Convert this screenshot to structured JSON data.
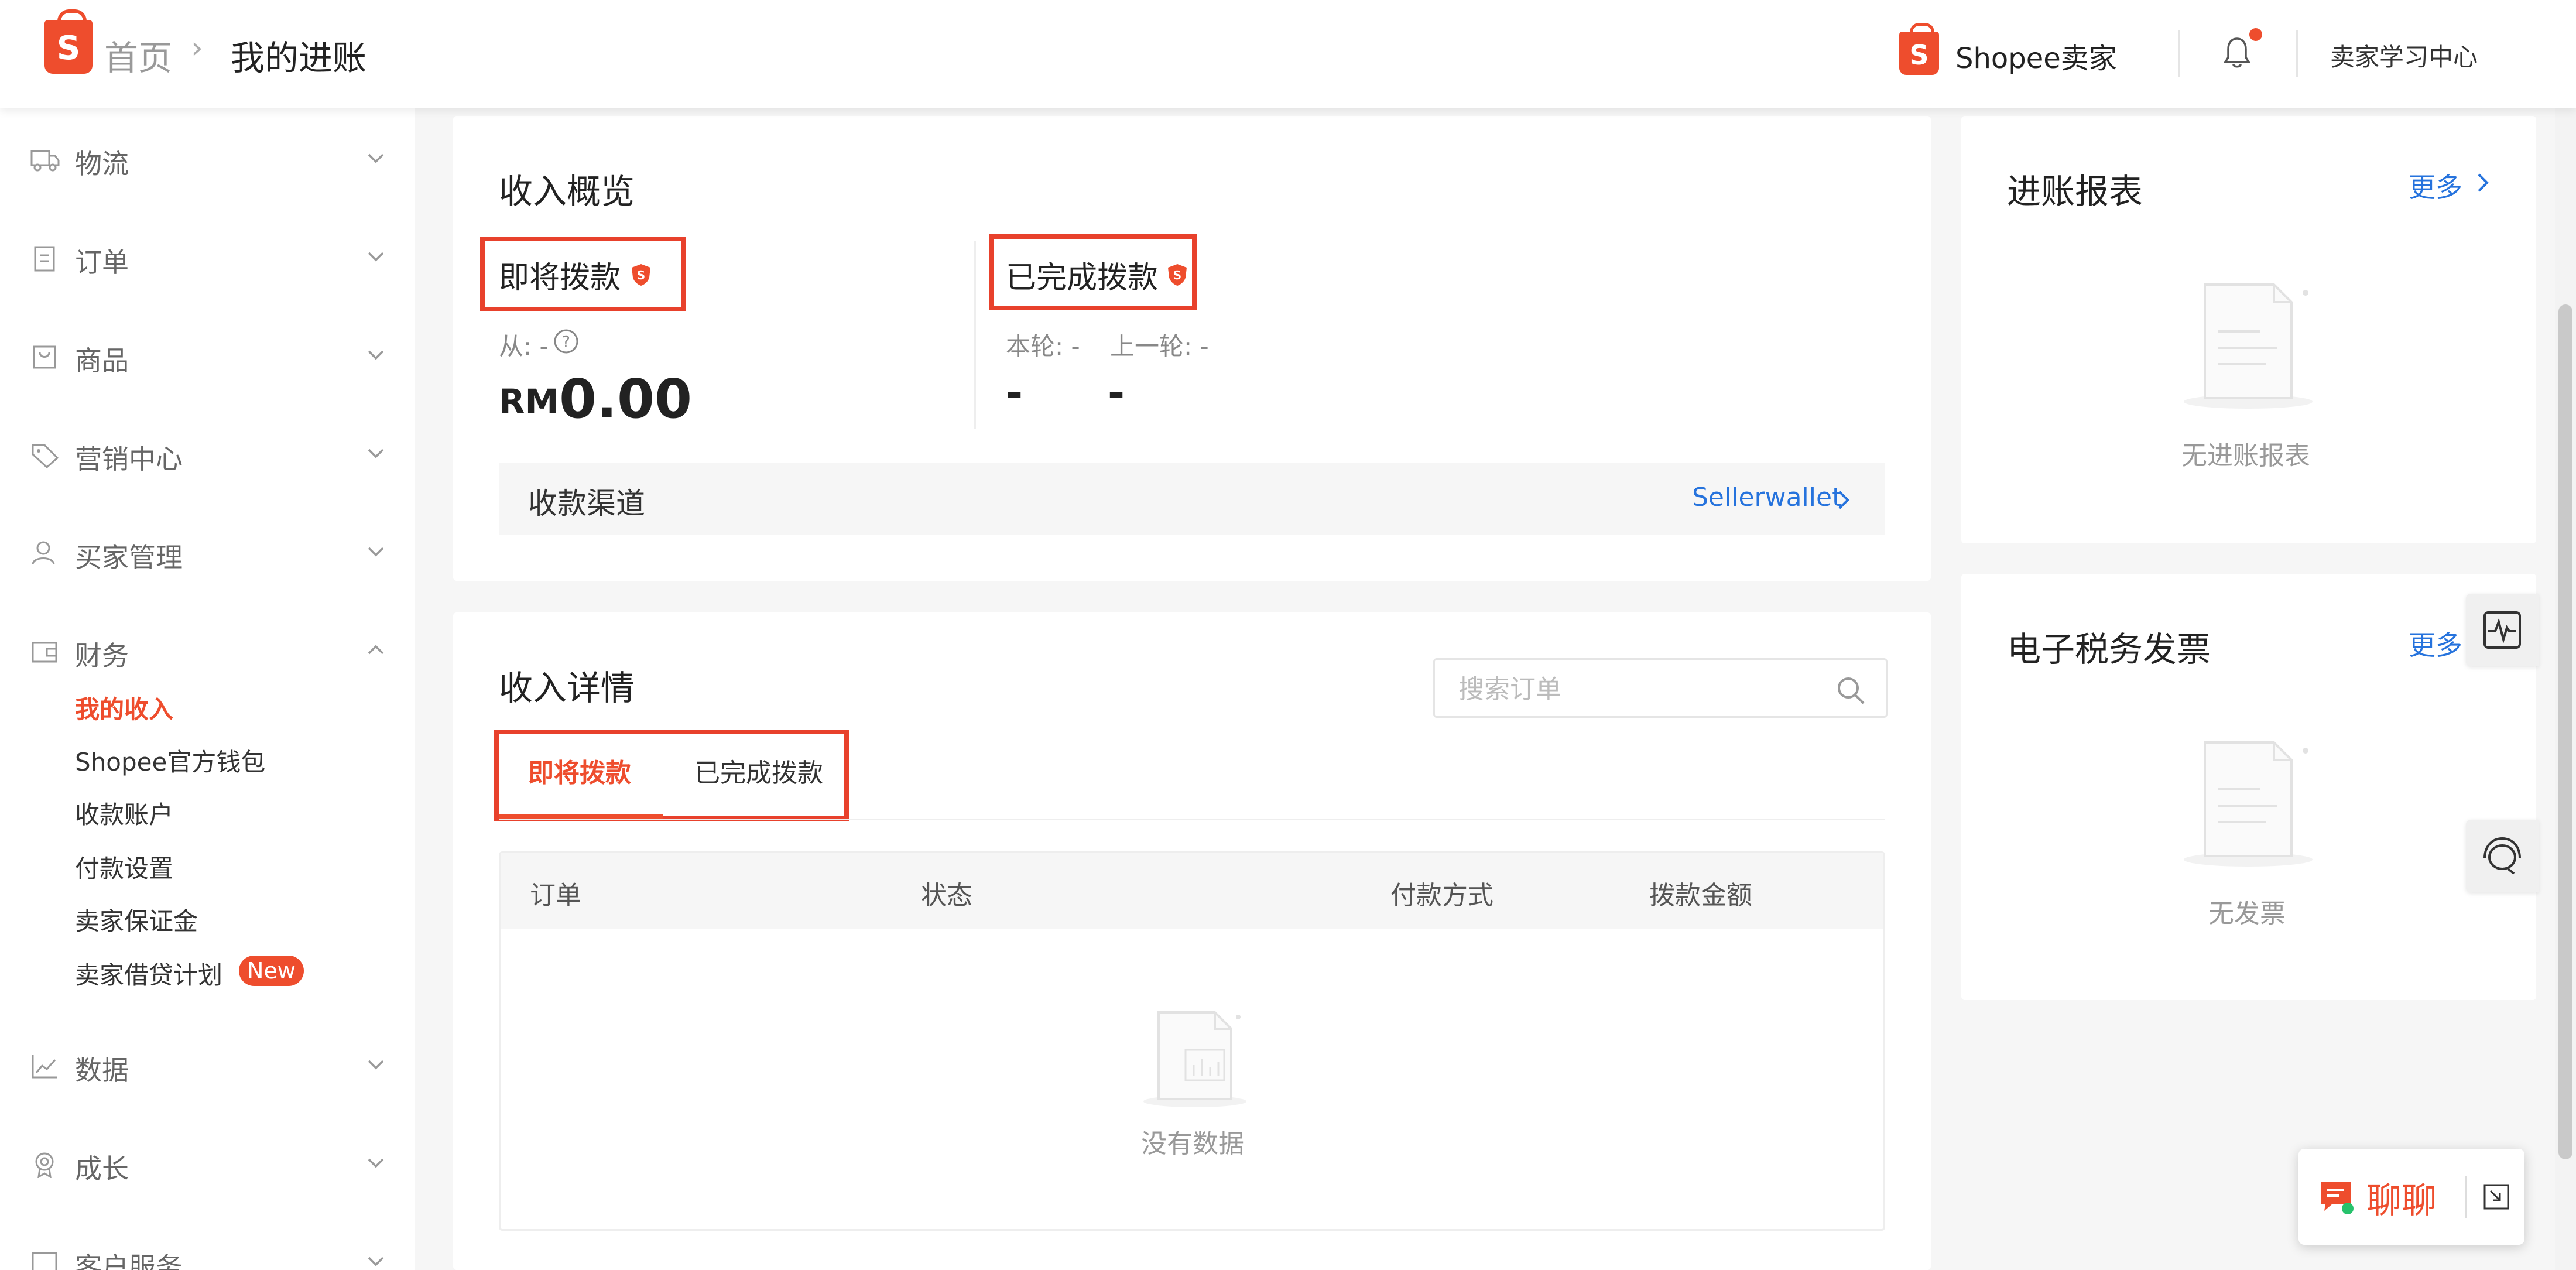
{
  "header": {
    "breadcrumb_home": "首页",
    "breadcrumb_sep": "›",
    "breadcrumb_current": "我的进账",
    "brand_text": "Shopee卖家",
    "learning_center": "卖家学习中心",
    "logo_letter": "S"
  },
  "sidebar": {
    "items": [
      {
        "label": "物流",
        "icon": "truck-icon"
      },
      {
        "label": "订单",
        "icon": "clipboard-icon"
      },
      {
        "label": "商品",
        "icon": "bag-icon"
      },
      {
        "label": "营销中心",
        "icon": "tag-icon"
      },
      {
        "label": "买家管理",
        "icon": "user-icon"
      },
      {
        "label": "财务",
        "icon": "wallet-icon"
      },
      {
        "label": "数据",
        "icon": "chart-icon"
      },
      {
        "label": "成长",
        "icon": "medal-icon"
      },
      {
        "label": "客户服务",
        "icon": "service-icon"
      }
    ],
    "finance_sub": [
      "我的收入",
      "Shopee官方钱包",
      "收款账户",
      "付款设置",
      "卖家保证金",
      "卖家借贷计划"
    ],
    "new_badge": "New"
  },
  "overview": {
    "title": "收入概览",
    "upcoming_label": "即将拨款",
    "upcoming_from": "从: -",
    "currency": "RM",
    "upcoming_amount": "0.00",
    "completed_label": "已完成拨款",
    "this_round": "本轮: -",
    "last_round": "上一轮: -",
    "this_round_value": "-",
    "last_round_value": "-",
    "channel_label": "收款渠道",
    "channel_link": "Sellerwallet"
  },
  "details": {
    "title": "收入详情",
    "search_placeholder": "搜索订单",
    "tabs": [
      "即将拨款",
      "已完成拨款"
    ],
    "columns": [
      "订单",
      "状态",
      "付款方式",
      "拨款金额"
    ],
    "empty_text": "没有数据"
  },
  "reports": {
    "title": "进账报表",
    "more": "更多",
    "empty_text": "无进账报表"
  },
  "invoice": {
    "title": "电子税务发票",
    "more": "更多",
    "empty_text": "无发票"
  },
  "chat": {
    "label": "聊聊"
  },
  "colors": {
    "brand": "#ee4d2d",
    "link": "#2673dd",
    "highlight_box": "#e8412c"
  }
}
